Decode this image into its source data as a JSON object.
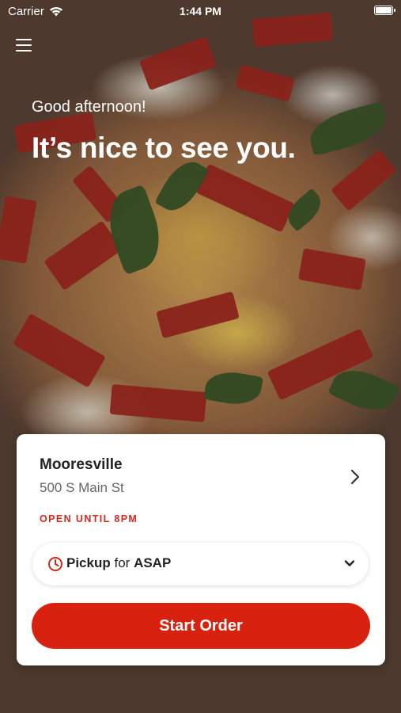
{
  "status_bar": {
    "carrier": "Carrier",
    "time": "1:44 PM"
  },
  "hero": {
    "greeting": "Good afternoon!",
    "headline": "It’s nice to see you."
  },
  "location_card": {
    "name": "Mooresville",
    "address": "500 S Main St",
    "hours_status": "OPEN UNTIL 8PM",
    "pickup": {
      "mode": "Pickup",
      "connector": "for",
      "time": "ASAP"
    },
    "start_order_label": "Start Order"
  },
  "colors": {
    "accent": "#d8220f",
    "open_status": "#d6291a"
  },
  "icons": {
    "menu": "hamburger-menu-icon",
    "wifi": "wifi-icon",
    "battery": "battery-icon",
    "chevron_right": "chevron-right-icon",
    "clock": "clock-icon",
    "chevron_down": "chevron-down-icon"
  }
}
